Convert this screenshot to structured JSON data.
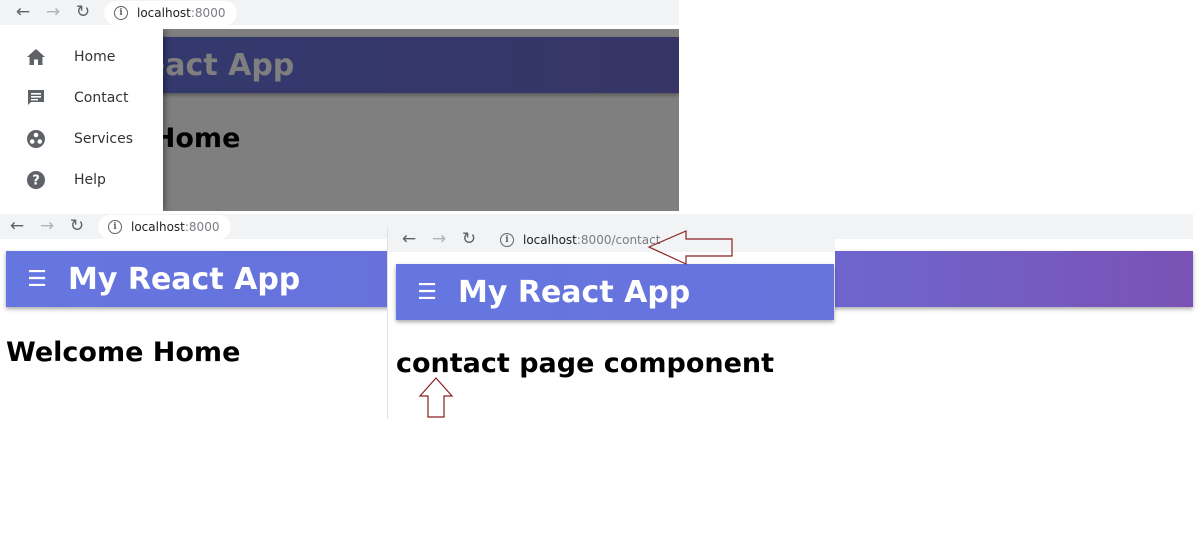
{
  "top_panel": {
    "address": {
      "host": "localhost",
      "rest": ":8000"
    },
    "app_title": "My React App",
    "heading": "Welcome Home",
    "drawer_items": [
      {
        "icon": "home-icon",
        "label": "Home"
      },
      {
        "icon": "message-icon",
        "label": "Contact"
      },
      {
        "icon": "services-icon",
        "label": "Services"
      },
      {
        "icon": "help-icon",
        "label": "Help"
      }
    ]
  },
  "left_panel": {
    "address": {
      "host": "localhost",
      "rest": ":8000"
    },
    "app_title": "My React App",
    "heading": "Welcome Home"
  },
  "right_panel": {
    "address": {
      "host": "localhost",
      "rest": ":8000/contact"
    },
    "app_title": "My React App",
    "heading": "contact page component"
  },
  "colors": {
    "appbar_start": "#6576e0",
    "appbar_end": "#7a52b5",
    "overlay": "rgba(0,0,0,0.5)",
    "annotation_arrow": "#8b2020"
  }
}
